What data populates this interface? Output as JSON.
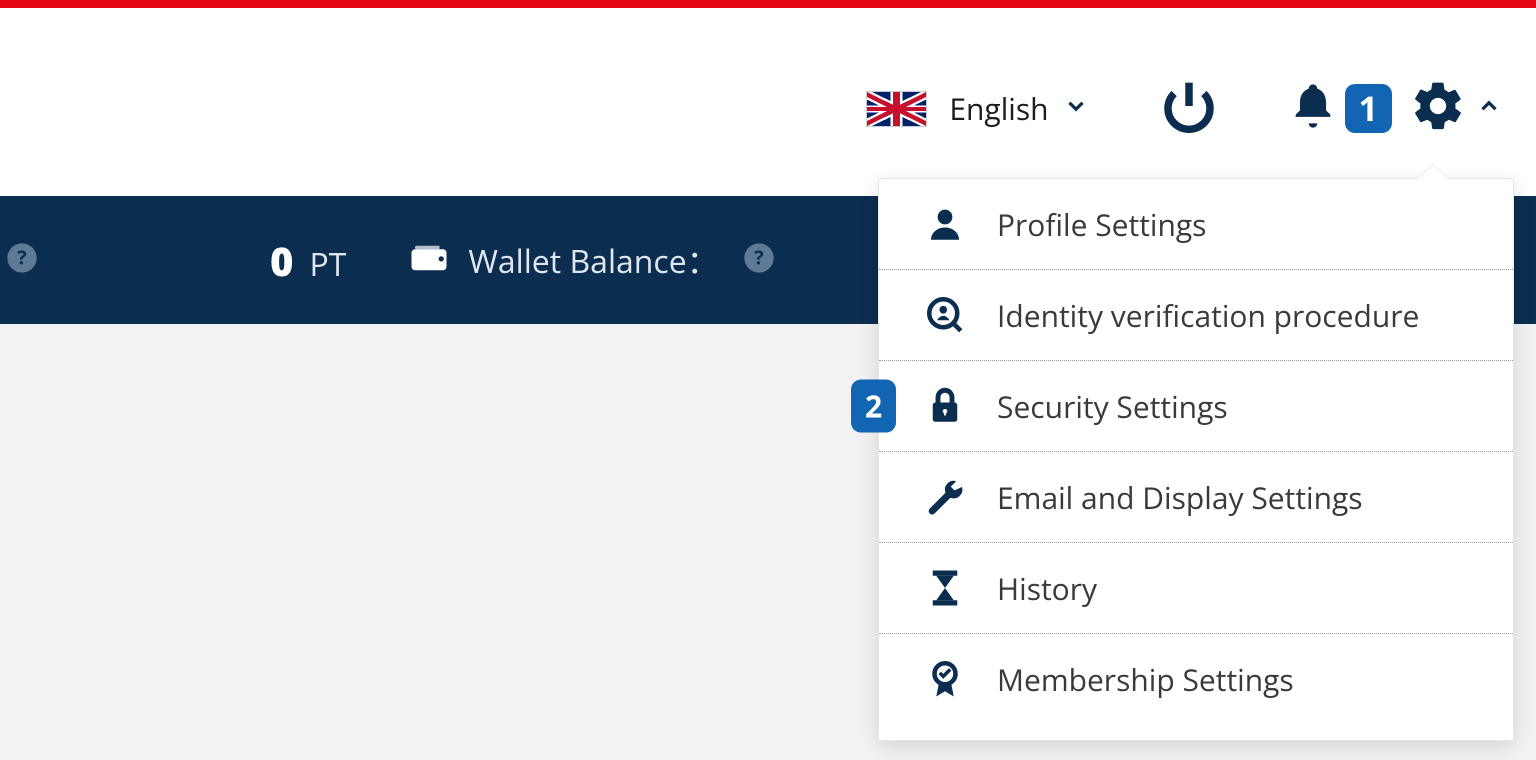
{
  "accent_color": "#1265b3",
  "dark_navy": "#0b2d50",
  "red": "#e30613",
  "header": {
    "language_label": "English",
    "notification_count": "1"
  },
  "statusbar": {
    "points_value": "0",
    "points_unit": "PT",
    "wallet_label": "Wallet Balance："
  },
  "menu": {
    "items": [
      {
        "label": "Profile Settings"
      },
      {
        "label": "Identity verification procedure"
      },
      {
        "label": "Security Settings",
        "badge": "2"
      },
      {
        "label": "Email and Display Settings"
      },
      {
        "label": "History"
      },
      {
        "label": "Membership Settings"
      }
    ]
  }
}
